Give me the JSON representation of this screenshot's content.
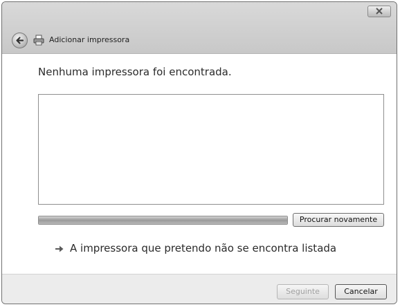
{
  "window": {
    "title": "Adicionar impressora",
    "close_icon": "close-icon",
    "back_icon": "back-arrow-icon",
    "printer_icon": "printer-icon"
  },
  "content": {
    "heading": "Nenhuma impressora foi encontrada.",
    "printer_list": [],
    "progress": {
      "fraction": 1.0
    },
    "search_again_label": "Procurar novamente",
    "link_label": "A impressora que pretendo não se encontra listada",
    "link_icon": "arrow-right-icon"
  },
  "footer": {
    "next_label": "Seguinte",
    "next_enabled": false,
    "cancel_label": "Cancelar"
  }
}
